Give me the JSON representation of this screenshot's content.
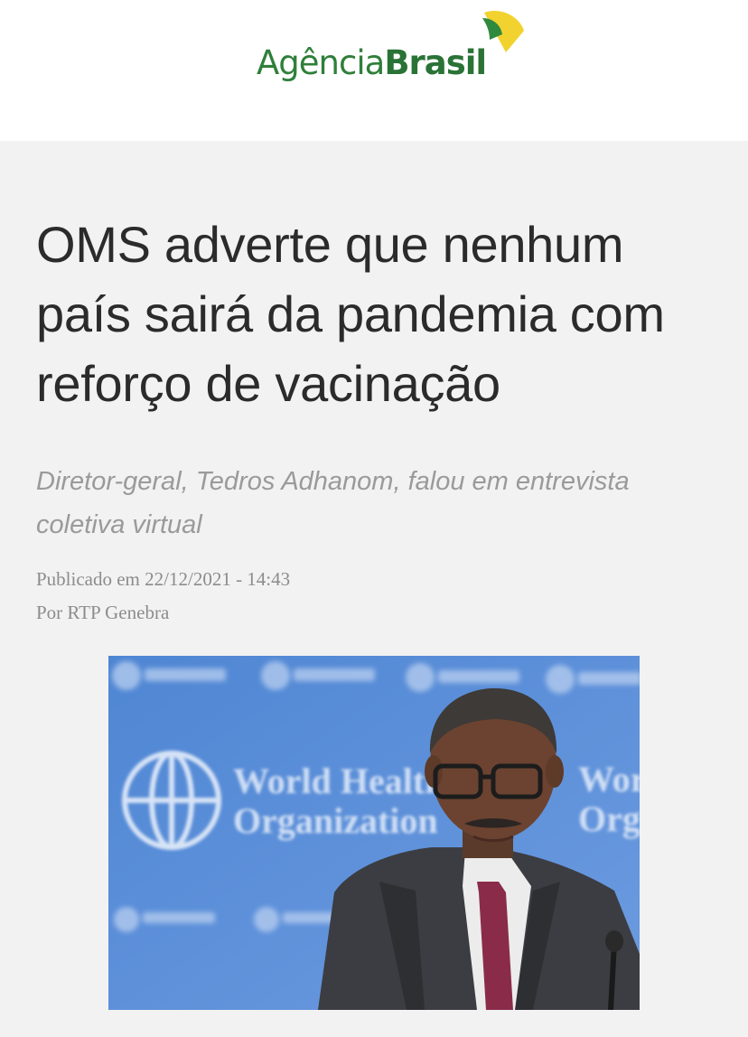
{
  "header": {
    "logo": {
      "part1": "Agência",
      "part2": "Brasil"
    }
  },
  "article": {
    "title": "OMS adverte que nenhum país sairá da pandemia com reforço de vacinação",
    "subtitle": "Diretor-geral, Tedros Adhanom, falou em entrevista coletiva virtual",
    "published": "Publicado em 22/12/2021 - 14:43",
    "author": "Por RTP Genebra",
    "photo": {
      "background_text": "World Health Organization",
      "background_color": "#5b8fd6"
    }
  },
  "colors": {
    "brand_green": "#2f7f3a",
    "brand_yellow": "#f2d22e",
    "page_bg": "#f2f2f2",
    "title_text": "#2b2b2b",
    "muted_text": "#9a9a9a"
  }
}
